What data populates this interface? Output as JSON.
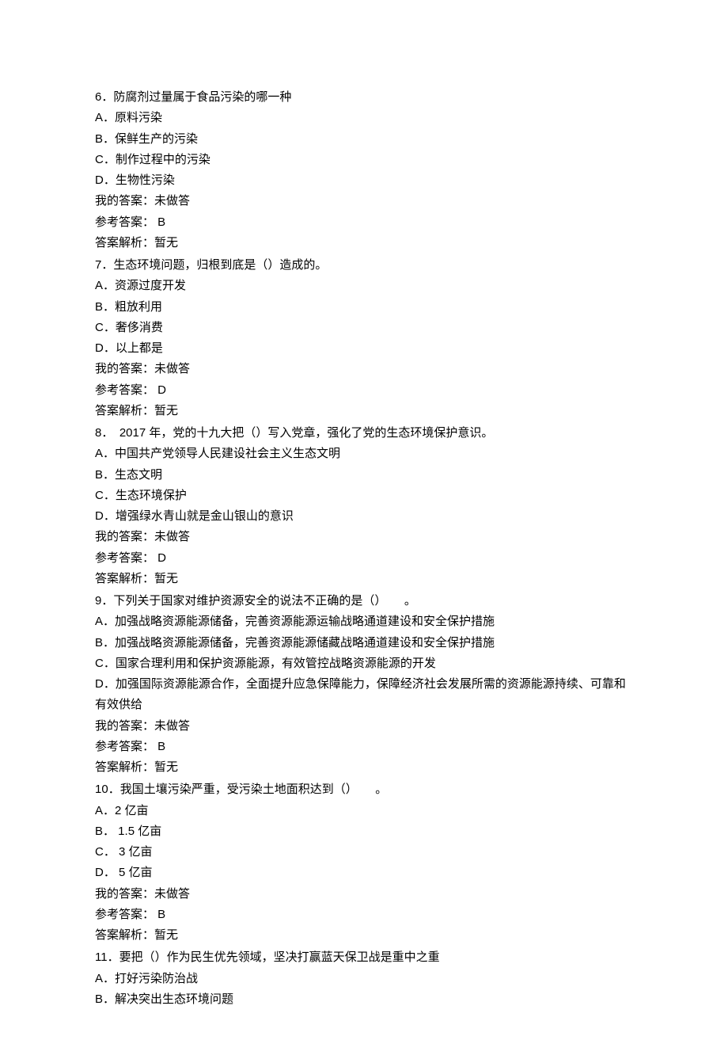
{
  "questions": [
    {
      "num": "6",
      "text": "．防腐剂过量属于食品污染的哪一种",
      "options": [
        {
          "label": "A．",
          "text": "原料污染"
        },
        {
          "label": "B．",
          "text": "保鲜生产的污染"
        },
        {
          "label": "C．",
          "text": "制作过程中的污染"
        },
        {
          "label": "D．",
          "text": "生物性污染"
        }
      ],
      "my_answer": "我的答案：未做答",
      "ref_answer": "参考答案： B",
      "explain": "答案解析：暂无"
    },
    {
      "num": "7",
      "text": "．生态环境问题，归根到底是（）造成的。",
      "options": [
        {
          "label": "A．",
          "text": "资源过度开发"
        },
        {
          "label": "B．",
          "text": "粗放利用"
        },
        {
          "label": "C．",
          "text": "奢侈消费"
        },
        {
          "label": "D．",
          "text": "以上都是"
        }
      ],
      "my_answer": "我的答案：未做答",
      "ref_answer": "参考答案： D",
      "explain": "答案解析：暂无"
    },
    {
      "num": "8",
      "text": "．　2017 年，党的十九大把（）写入党章，强化了党的生态环境保护意识。",
      "options": [
        {
          "label": "A．",
          "text": "中国共产党领导人民建设社会主义生态文明"
        },
        {
          "label": "B．",
          "text": "生态文明"
        },
        {
          "label": "C．",
          "text": "生态环境保护"
        },
        {
          "label": "D．",
          "text": "增强绿水青山就是金山银山的意识"
        }
      ],
      "my_answer": "我的答案：未做答",
      "ref_answer": "参考答案： D",
      "explain": "答案解析：暂无"
    },
    {
      "num": "9",
      "text": "．下列关于国家对维护资源安全的说法不正确的是（）　　。",
      "options": [
        {
          "label": "A．",
          "text": "加强战略资源能源储备，完善资源能源运输战略通道建设和安全保护措施"
        },
        {
          "label": "B．",
          "text": "加强战略资源能源储备，完善资源能源储藏战略通道建设和安全保护措施"
        },
        {
          "label": "C．",
          "text": "国家合理利用和保护资源能源，有效管控战略资源能源的开发"
        },
        {
          "label": "D．",
          "text": "加强国际资源能源合作，全面提升应急保障能力，保障经济社会发展所需的资源能源持续、可靠和有效供给"
        }
      ],
      "my_answer": "我的答案：未做答",
      "ref_answer": "参考答案： B",
      "explain": "答案解析：暂无"
    },
    {
      "num": "10",
      "text": "．我国土壤污染严重，受污染土地面积达到（）　　。",
      "options": [
        {
          "label": "A．",
          "text": "2 亿亩"
        },
        {
          "label": "B．",
          "text": " 1.5 亿亩"
        },
        {
          "label": "C．",
          "text": " 3 亿亩"
        },
        {
          "label": "D．",
          "text": " 5 亿亩"
        }
      ],
      "my_answer": "我的答案：未做答",
      "ref_answer": "参考答案： B",
      "explain": "答案解析：暂无"
    },
    {
      "num": "11",
      "text": "．要把（）作为民生优先领域，坚决打赢蓝天保卫战是重中之重",
      "options": [
        {
          "label": "A．",
          "text": "打好污染防治战"
        },
        {
          "label": "B．",
          "text": "解决突出生态环境问题"
        }
      ],
      "my_answer": "",
      "ref_answer": "",
      "explain": ""
    }
  ]
}
